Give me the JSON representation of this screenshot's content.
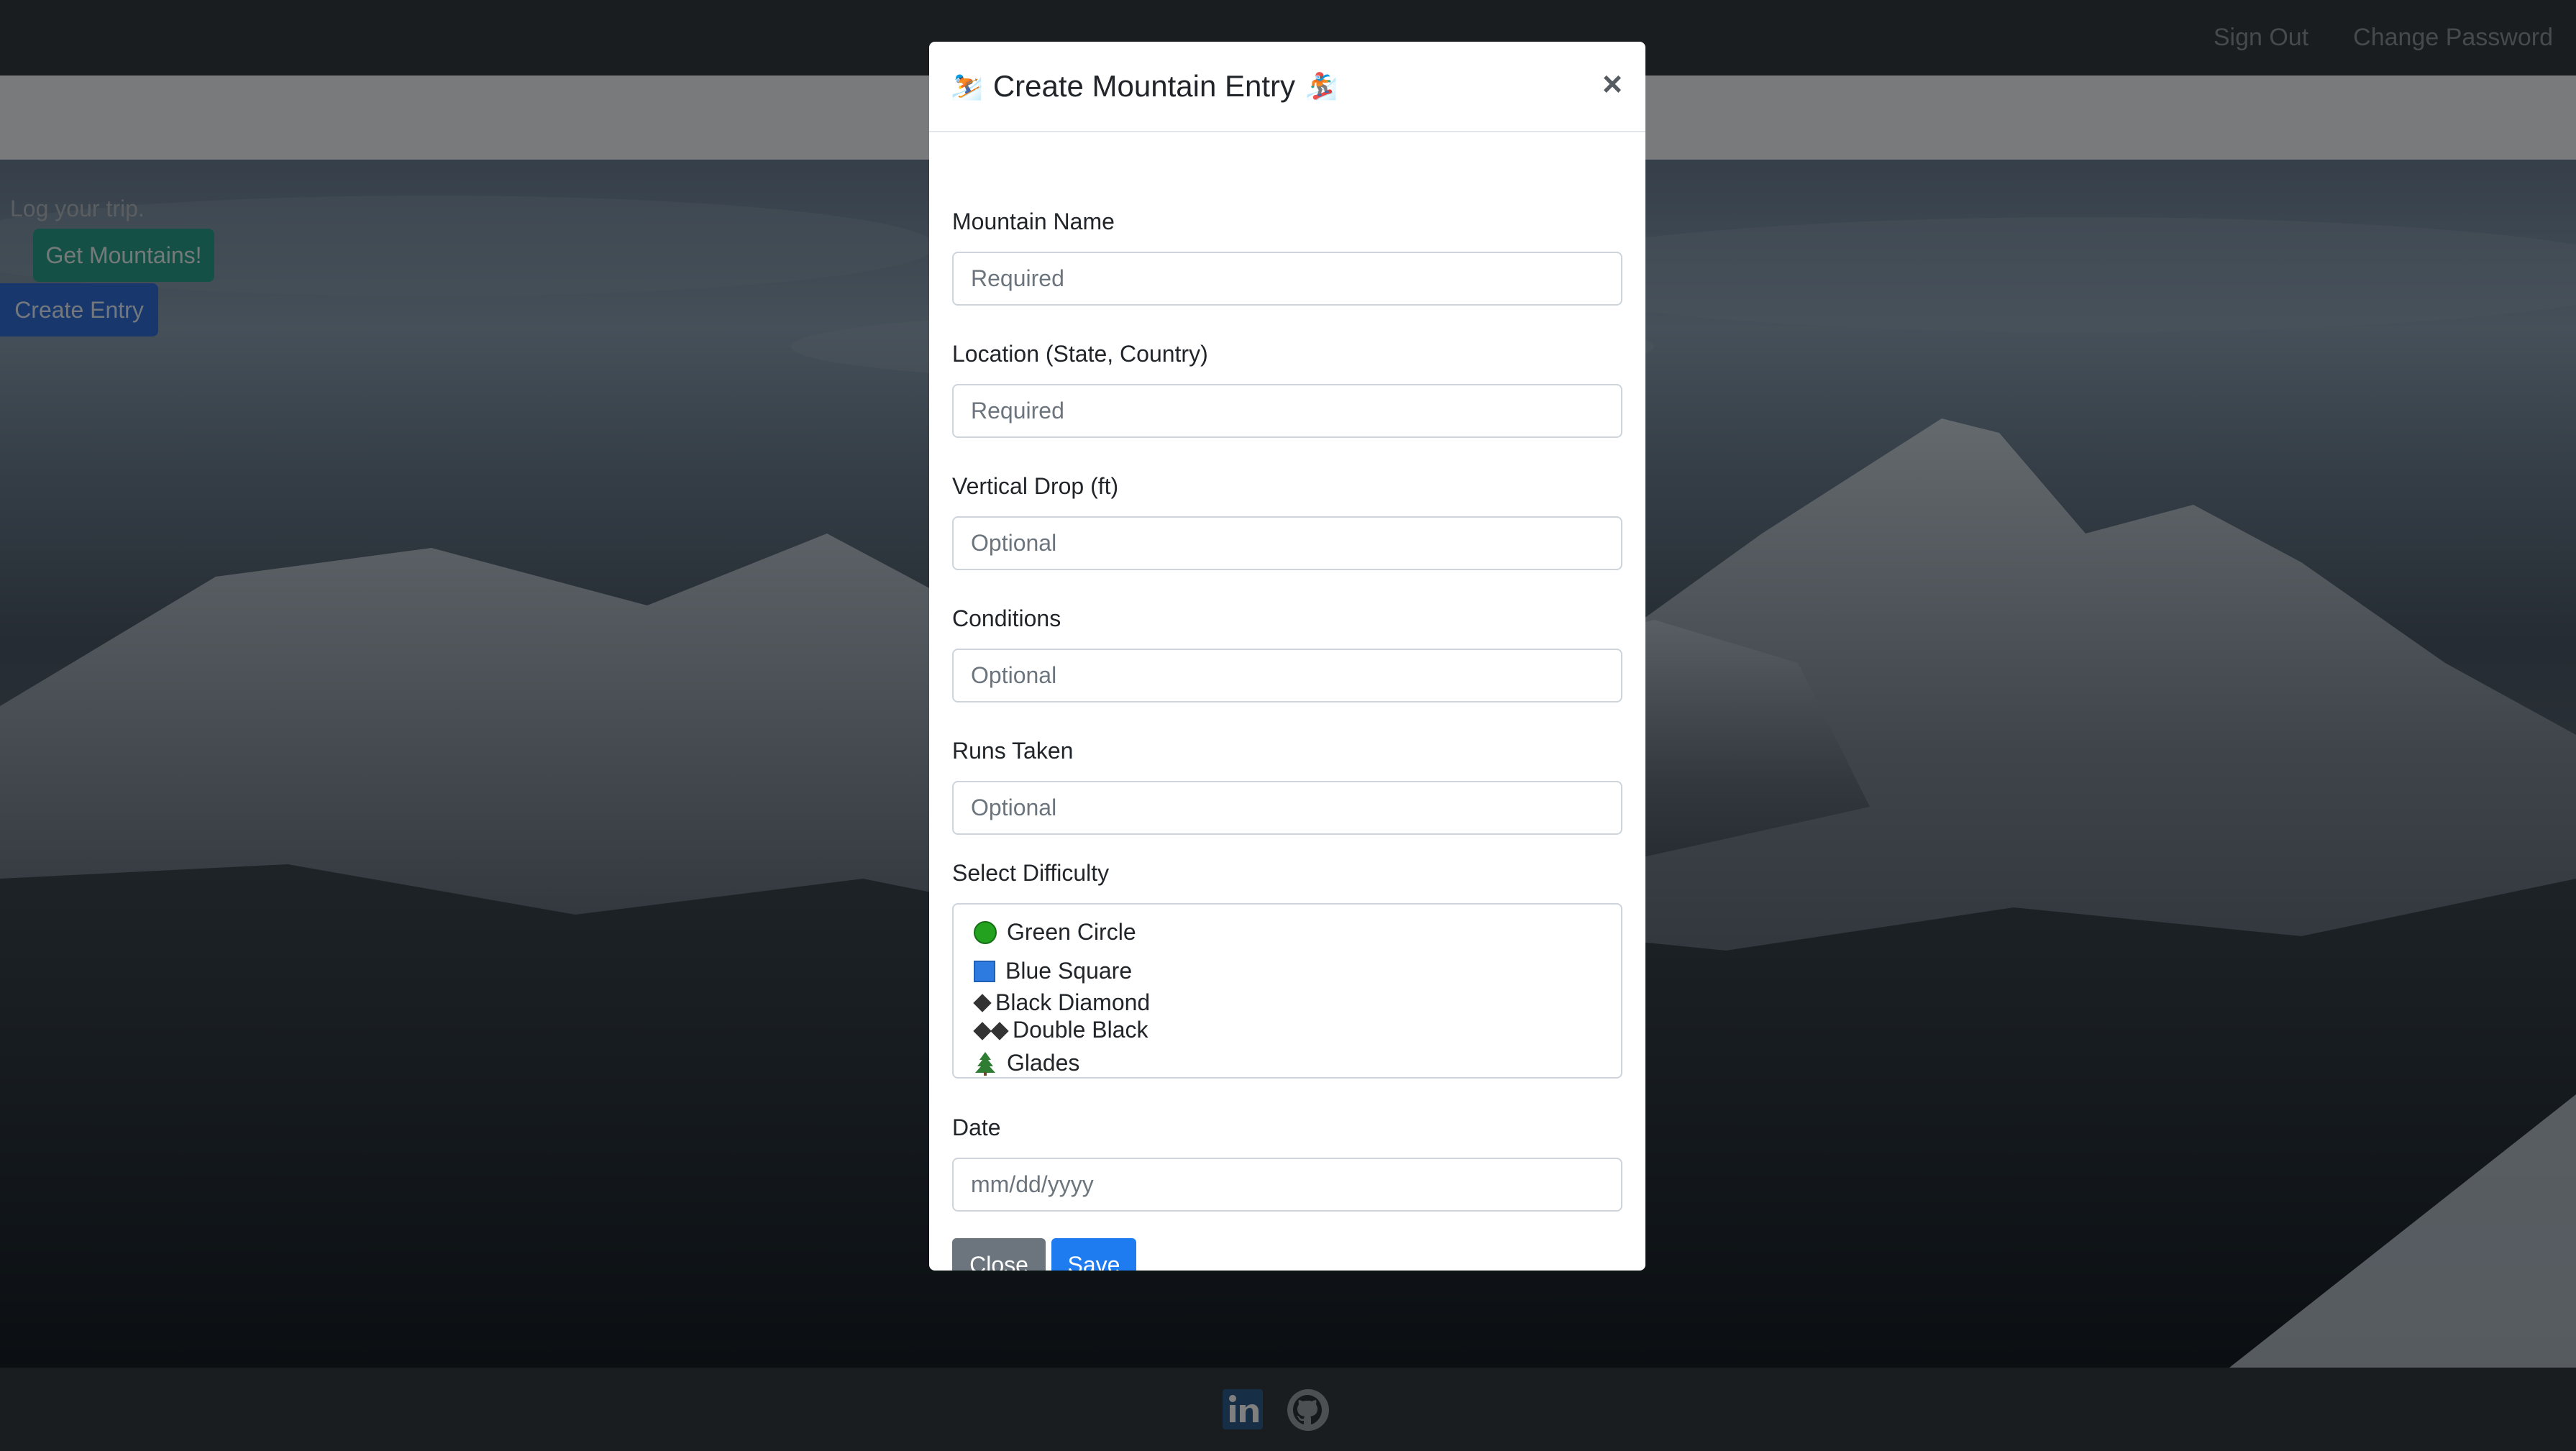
{
  "nav": {
    "sign_out": "Sign Out",
    "change_password": "Change Password"
  },
  "page": {
    "tagline": "Log your trip.",
    "get_mountains": "Get Mountains!",
    "create_entry": "Create Entry"
  },
  "footer": {
    "linkedin_icon": "linkedin-icon",
    "github_icon": "github-icon"
  },
  "modal": {
    "title": "Create Mountain Entry",
    "title_left_emoji": "⛷️",
    "title_right_emoji": "🏂",
    "close_glyph": "×",
    "fields": [
      {
        "label": "Mountain Name",
        "placeholder": "Required"
      },
      {
        "label": "Location (State, Country)",
        "placeholder": "Required"
      },
      {
        "label": "Vertical Drop (ft)",
        "placeholder": "Optional"
      },
      {
        "label": "Conditions",
        "placeholder": "Optional"
      },
      {
        "label": "Runs Taken",
        "placeholder": "Optional"
      }
    ],
    "difficulty": {
      "label": "Select Difficulty",
      "options": [
        "Green Circle",
        "Blue Square",
        "Black Diamond",
        "Double Black",
        "Glades"
      ]
    },
    "date": {
      "label": "Date",
      "placeholder": "mm/dd/yyyy"
    },
    "buttons": {
      "close": "Close",
      "save": "Save"
    }
  },
  "colors": {
    "navbar": "#343a40",
    "primary": "#1f7cf0",
    "secondary": "#6c757d",
    "teal": "#2aa18f"
  }
}
